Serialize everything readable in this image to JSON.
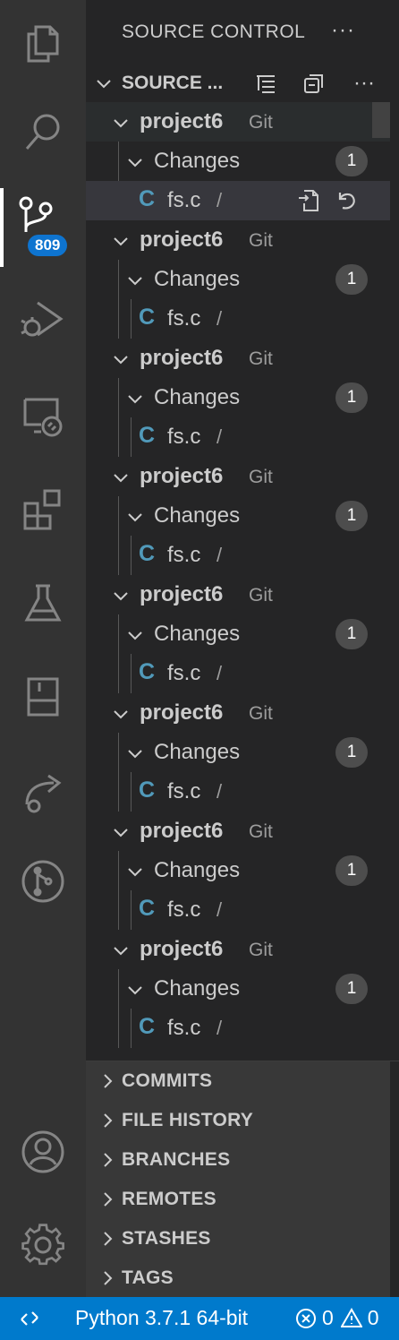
{
  "activity_bar": {
    "scm_badge": "809",
    "items": [
      "explorer-icon",
      "search-icon",
      "source-control-icon",
      "run-debug-icon",
      "remote-explorer-icon",
      "extensions-icon",
      "testing-icon",
      "bookmarks-icon",
      "live-share-icon",
      "gitlens-icon",
      "accounts-icon",
      "settings-gear-icon"
    ]
  },
  "sidebar": {
    "title": "SOURCE CONTROL",
    "more": "···",
    "section_title": "SOURCE ...",
    "repos": [
      {
        "name": "project6",
        "type": "Git",
        "group": "Changes",
        "count": "1",
        "file_icon": "C",
        "file_name": "fs.c",
        "file_path": "/"
      },
      {
        "name": "project6",
        "type": "Git",
        "group": "Changes",
        "count": "1",
        "file_icon": "C",
        "file_name": "fs.c",
        "file_path": "/"
      },
      {
        "name": "project6",
        "type": "Git",
        "group": "Changes",
        "count": "1",
        "file_icon": "C",
        "file_name": "fs.c",
        "file_path": "/"
      },
      {
        "name": "project6",
        "type": "Git",
        "group": "Changes",
        "count": "1",
        "file_icon": "C",
        "file_name": "fs.c",
        "file_path": "/"
      },
      {
        "name": "project6",
        "type": "Git",
        "group": "Changes",
        "count": "1",
        "file_icon": "C",
        "file_name": "fs.c",
        "file_path": "/"
      },
      {
        "name": "project6",
        "type": "Git",
        "group": "Changes",
        "count": "1",
        "file_icon": "C",
        "file_name": "fs.c",
        "file_path": "/"
      },
      {
        "name": "project6",
        "type": "Git",
        "group": "Changes",
        "count": "1",
        "file_icon": "C",
        "file_name": "fs.c",
        "file_path": "/"
      },
      {
        "name": "project6",
        "type": "Git",
        "group": "Changes",
        "count": "1",
        "file_icon": "C",
        "file_name": "fs.c",
        "file_path": "/"
      }
    ],
    "panels": [
      "COMMITS",
      "FILE HISTORY",
      "BRANCHES",
      "REMOTES",
      "STASHES",
      "TAGS"
    ]
  },
  "statusbar": {
    "python": "Python 3.7.1 64-bit",
    "errors": "0",
    "warnings": "0"
  }
}
